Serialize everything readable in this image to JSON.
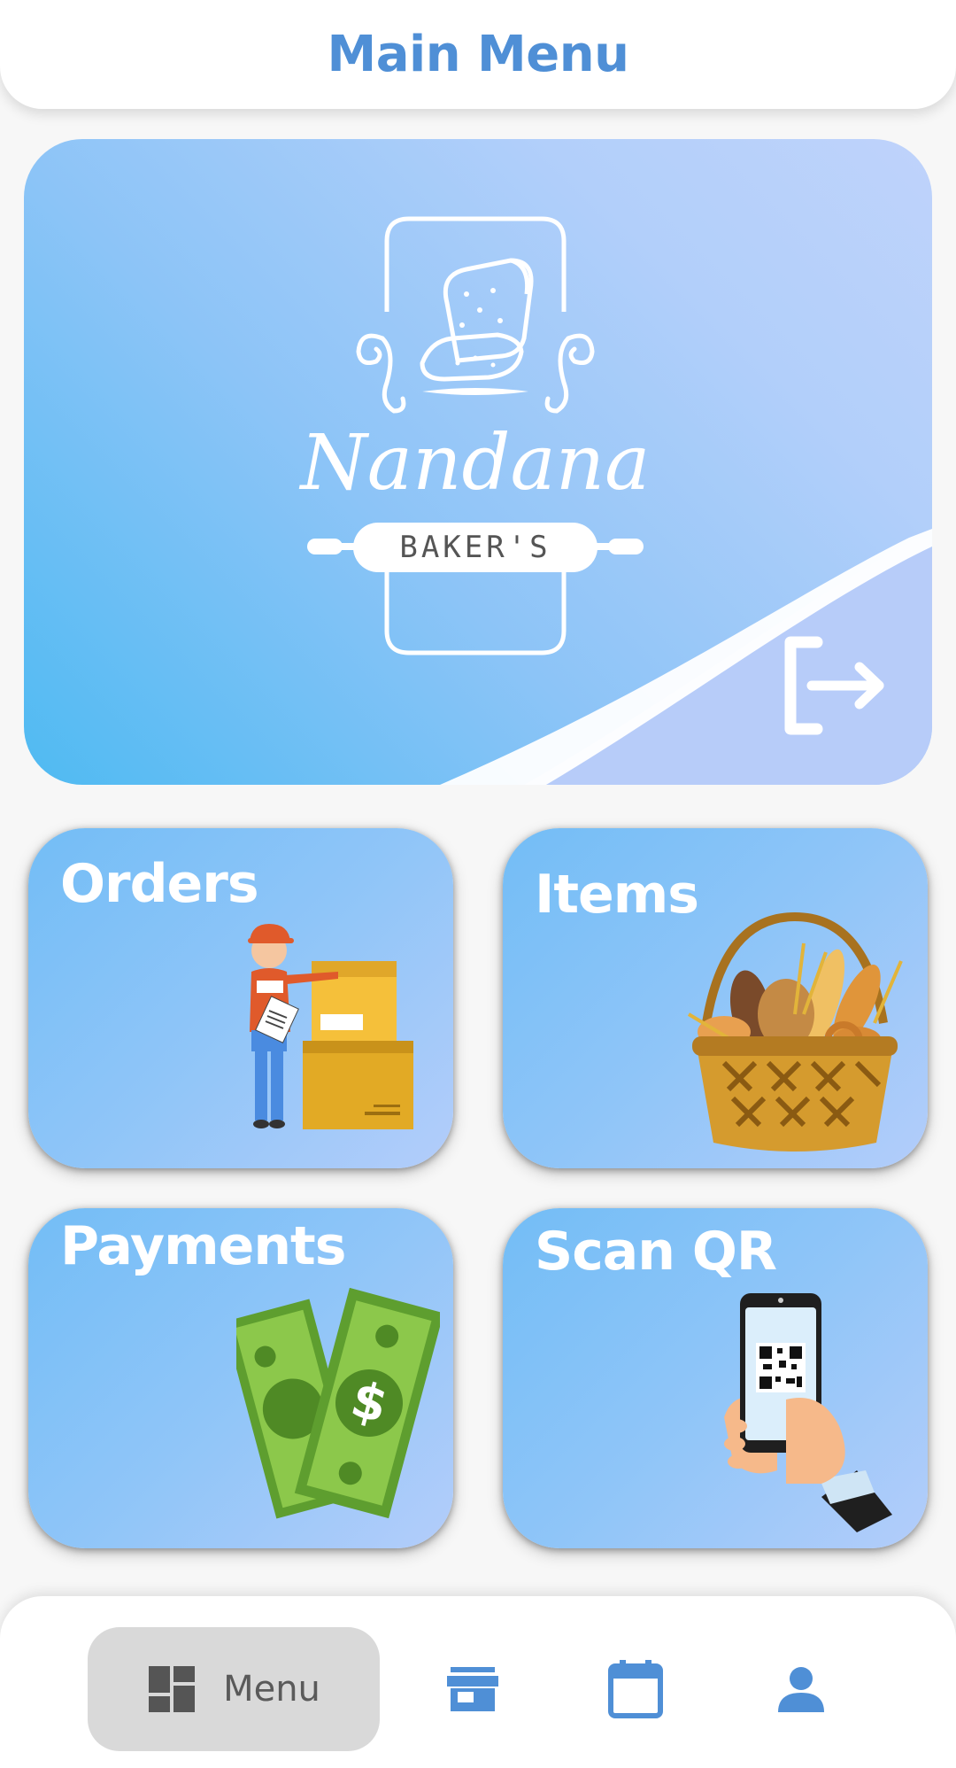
{
  "header": {
    "title": "Main Menu"
  },
  "banner": {
    "logo": {
      "brand_script": "Nandana",
      "brand_sub": "BAKER'S"
    },
    "logout_icon": "logout-icon"
  },
  "cards": [
    {
      "id": "orders",
      "label": "Orders",
      "illustration": "delivery-person-boxes"
    },
    {
      "id": "items",
      "label": "Items",
      "illustration": "bread-basket"
    },
    {
      "id": "payments",
      "label": "Payments",
      "illustration": "dollar-bills"
    },
    {
      "id": "scan",
      "label": "Scan QR",
      "illustration": "phone-qr-code"
    }
  ],
  "bottom_nav": {
    "items": [
      {
        "label": "Menu",
        "icon": "dashboard-icon",
        "active": true
      },
      {
        "label": "",
        "icon": "store-icon",
        "active": false
      },
      {
        "label": "",
        "icon": "calendar-icon",
        "active": false
      },
      {
        "label": "",
        "icon": "person-icon",
        "active": false
      }
    ]
  },
  "colors": {
    "accent": "#4f8fd6",
    "card_start": "#73bdf6",
    "card_end": "#b3cdfa",
    "banner_start": "#4fbaf2",
    "nav_active_bg": "#d9d9d9"
  }
}
